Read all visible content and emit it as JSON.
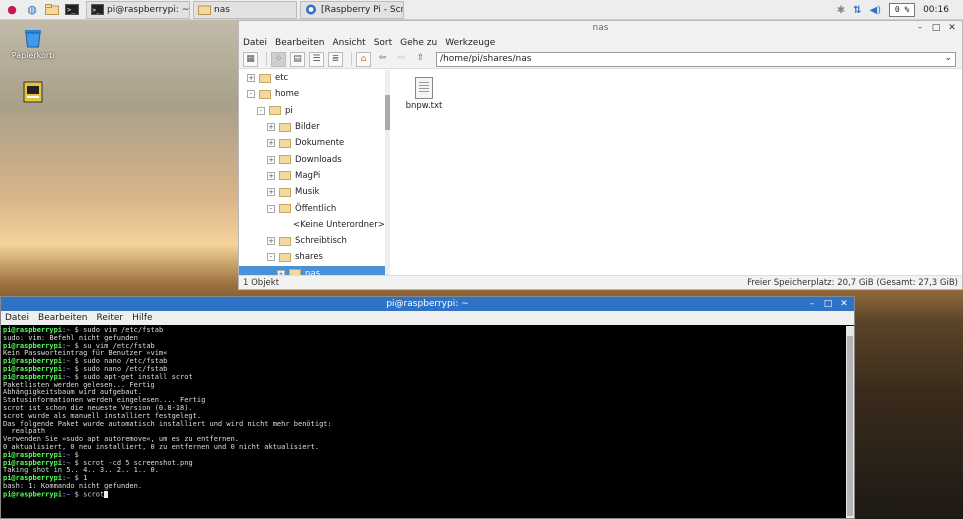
{
  "taskbar": {
    "tasks": [
      {
        "label": "pi@raspberrypi: ~",
        "icon": "terminal-icon"
      },
      {
        "label": "nas",
        "icon": "folder-icon"
      },
      {
        "label": "[Raspberry Pi - Scree...",
        "icon": "browser-icon"
      }
    ],
    "cpu": "0 %",
    "clock": "00:16"
  },
  "desktop": {
    "trash_label": "Papierkorb"
  },
  "file_manager": {
    "title": "nas",
    "menu": [
      "Datei",
      "Bearbeiten",
      "Ansicht",
      "Sort",
      "Gehe zu",
      "Werkzeuge"
    ],
    "path": "/home/pi/shares/nas",
    "tree": [
      {
        "label": "etc",
        "level": 1,
        "exp": "+"
      },
      {
        "label": "home",
        "level": 1,
        "exp": "-"
      },
      {
        "label": "pi",
        "level": 2,
        "exp": "-"
      },
      {
        "label": "Bilder",
        "level": 3,
        "exp": "+"
      },
      {
        "label": "Dokumente",
        "level": 3,
        "exp": "+"
      },
      {
        "label": "Downloads",
        "level": 3,
        "exp": "+"
      },
      {
        "label": "MagPi",
        "level": 3,
        "exp": "+"
      },
      {
        "label": "Musik",
        "level": 3,
        "exp": "+"
      },
      {
        "label": "Öffentlich",
        "level": 3,
        "exp": "-"
      },
      {
        "label": "<Keine Unterordner>",
        "level": 4,
        "exp": ""
      },
      {
        "label": "Schreibtisch",
        "level": 3,
        "exp": "+"
      },
      {
        "label": "shares",
        "level": 3,
        "exp": "-"
      },
      {
        "label": "nas",
        "level": 4,
        "exp": "+"
      }
    ],
    "files": [
      {
        "name": "bnpw.txt"
      }
    ],
    "status_left": "1 Objekt",
    "status_right": "Freier Speicherplatz: 20,7 GiB (Gesamt: 27,3 GiB)"
  },
  "terminal": {
    "title": "pi@raspberrypi: ~",
    "menu": [
      "Datei",
      "Bearbeiten",
      "Reiter",
      "Hilfe"
    ],
    "lines": [
      {
        "prompt": "pi@raspberrypi",
        "dir": "~",
        "cmd": "sudo vim /etc/fstab"
      },
      {
        "out": "sudo: vim: Befehl nicht gefunden"
      },
      {
        "prompt": "pi@raspberrypi",
        "dir": "~",
        "cmd": "su vim /etc/fstab"
      },
      {
        "out": "Kein Passworteintrag für Benutzer »vim«"
      },
      {
        "prompt": "pi@raspberrypi",
        "dir": "~",
        "cmd": "sudo nano /etc/fstab"
      },
      {
        "prompt": "pi@raspberrypi",
        "dir": "~",
        "cmd": "sudo nano /etc/fstab"
      },
      {
        "prompt": "pi@raspberrypi",
        "dir": "~",
        "cmd": "sudo apt-get install scrot"
      },
      {
        "out": "Paketlisten werden gelesen... Fertig"
      },
      {
        "out": "Abhängigkeitsbaum wird aufgebaut."
      },
      {
        "out": "Statusinformationen werden eingelesen.... Fertig"
      },
      {
        "out": "scrot ist schon die neueste Version (0.8-18)."
      },
      {
        "out": "scrot wurde als manuell installiert festgelegt."
      },
      {
        "out": "Das folgende Paket wurde automatisch installiert und wird nicht mehr benötigt:"
      },
      {
        "out": "  realpath"
      },
      {
        "out": "Verwenden Sie »sudo apt autoremove«, um es zu entfernen."
      },
      {
        "out": "0 aktualisiert, 0 neu installiert, 0 zu entfernen und 0 nicht aktualisiert."
      },
      {
        "prompt": "pi@raspberrypi",
        "dir": "~",
        "cmd": ""
      },
      {
        "prompt": "pi@raspberrypi",
        "dir": "~",
        "cmd": "scrot -cd 5 screenshot.png"
      },
      {
        "out": "Taking shot in 5.. 4.. 3.. 2.. 1.. 0."
      },
      {
        "prompt": "pi@raspberrypi",
        "dir": "~",
        "cmd": "1"
      },
      {
        "out": "bash: 1: Kommando nicht gefunden."
      },
      {
        "prompt": "pi@raspberrypi",
        "dir": "~",
        "cmd": "scrot",
        "cursor": true
      }
    ]
  }
}
